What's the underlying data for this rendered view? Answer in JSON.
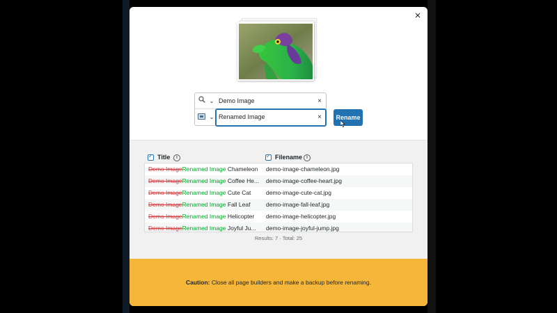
{
  "modal": {
    "close_label": "×"
  },
  "search": {
    "find_value": "Demo Image",
    "replace_value": "Renamed Image",
    "clear_label": "×",
    "find_icon": "magnifier-icon",
    "replace_icon": "image-icon",
    "chevron": "⌄"
  },
  "rename_button": {
    "label": "Rename"
  },
  "columns": {
    "title": "Title",
    "filename": "Filename"
  },
  "rows": [
    {
      "old": "Demo Image",
      "new": "Renamed Image",
      "rest": " Chameleon",
      "filename": "demo-image-chameleon.jpg"
    },
    {
      "old": "Demo Image",
      "new": "Renamed Image",
      "rest": " Coffee He...",
      "filename": "demo-image-coffee-heart.jpg"
    },
    {
      "old": "Demo Image",
      "new": "Renamed Image",
      "rest": " Cute Cat",
      "filename": "demo-image-cute-cat.jpg"
    },
    {
      "old": "Demo Image",
      "new": "Renamed Image",
      "rest": " Fall Leaf",
      "filename": "demo-image-fall-leaf.jpg"
    },
    {
      "old": "Demo Image",
      "new": "Renamed Image",
      "rest": " Helicopter",
      "filename": "demo-image-helicopter.jpg"
    },
    {
      "old": "Demo Image",
      "new": "Renamed Image",
      "rest": " Joyful Ju...",
      "filename": "demo-image-joyful-jump.jpg"
    }
  ],
  "results": {
    "text": "Results: 7 · Total: 25"
  },
  "caution": {
    "label": "Caution:",
    "text": " Close all page builders and make a backup before renaming."
  },
  "colors": {
    "accent": "#2271b1",
    "old_text": "#d63638",
    "new_text": "#00a32a",
    "caution_bg": "#f5b63a"
  }
}
